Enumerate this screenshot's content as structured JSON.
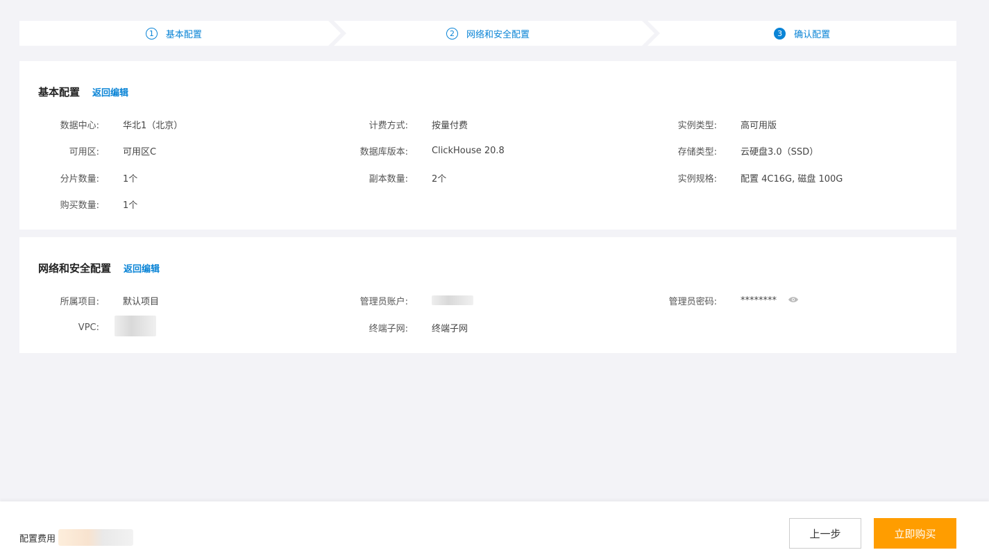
{
  "steps": [
    {
      "num": "1",
      "label": "基本配置"
    },
    {
      "num": "2",
      "label": "网络和安全配置"
    },
    {
      "num": "3",
      "label": "确认配置"
    }
  ],
  "basic": {
    "title": "基本配置",
    "edit_link": "返回编辑",
    "fields": {
      "datacenter": {
        "label": "数据中心:",
        "value": "华北1（北京）"
      },
      "billing": {
        "label": "计费方式:",
        "value": "按量付费"
      },
      "instance_type": {
        "label": "实例类型:",
        "value": "高可用版"
      },
      "zone": {
        "label": "可用区:",
        "value": "可用区C"
      },
      "db_version": {
        "label": "数据库版本:",
        "value": "ClickHouse 20.8"
      },
      "storage_type": {
        "label": "存储类型:",
        "value": "云硬盘3.0（SSD）"
      },
      "shards": {
        "label": "分片数量:",
        "value": "1个"
      },
      "replicas": {
        "label": "副本数量:",
        "value": "2个"
      },
      "spec": {
        "label": "实例规格:",
        "value": "配置 4C16G, 磁盘 100G"
      },
      "purchase_count": {
        "label": "购买数量:",
        "value": "1个"
      }
    }
  },
  "network": {
    "title": "网络和安全配置",
    "edit_link": "返回编辑",
    "fields": {
      "project": {
        "label": "所属项目:",
        "value": "默认项目"
      },
      "admin_account": {
        "label": "管理员账户:"
      },
      "admin_password": {
        "label": "管理员密码:",
        "value": "********"
      },
      "vpc": {
        "label": "VPC:"
      },
      "subnet": {
        "label": "终端子网:",
        "value": "终端子网"
      }
    }
  },
  "footer": {
    "fee_label": "配置费用",
    "prev_label": "上一步",
    "buy_label": "立即购买"
  },
  "colors": {
    "accent": "#0a84d6",
    "buy_button": "#ff9d00",
    "background": "#f3f3f7"
  }
}
